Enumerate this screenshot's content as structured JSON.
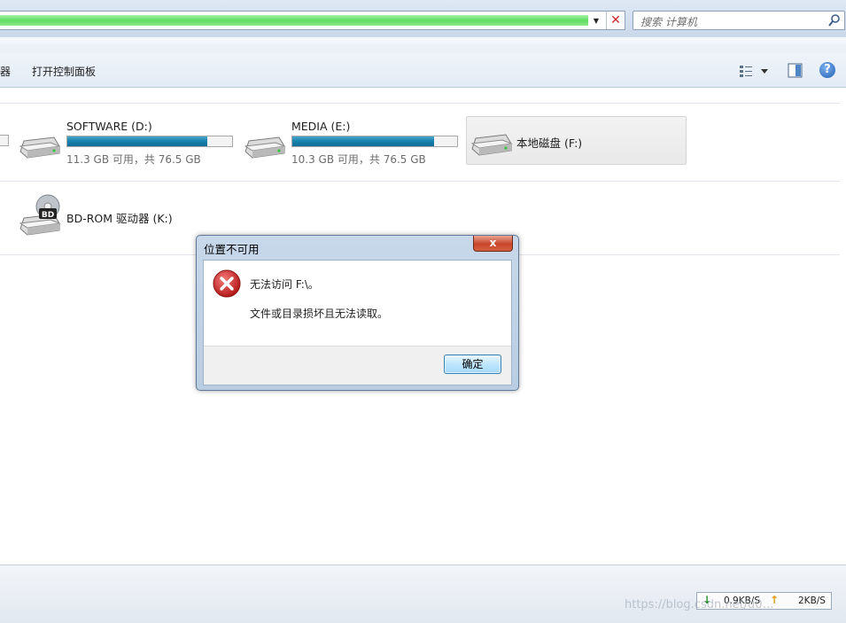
{
  "address_bar": {
    "search_placeholder": "搜索 计算机"
  },
  "toolbar": {
    "cut_label": "器",
    "open_control_panel": "打开控制面板"
  },
  "drives": [
    {
      "name": "SOFTWARE (D:)",
      "size": "11.3 GB 可用，共 76.5 GB",
      "used_fraction": 0.85
    },
    {
      "name": "MEDIA (E:)",
      "size": "10.3 GB 可用，共 76.5 GB",
      "used_fraction": 0.86
    },
    {
      "name": "本地磁盘 (F:)"
    },
    {
      "name": "BD-ROM 驱动器 (K:)",
      "badge": "BD"
    }
  ],
  "dialog": {
    "title": "位置不可用",
    "close": "x",
    "message1": "无法访问 F:\\。",
    "message2": "文件或目录损坏且无法读取。",
    "ok": "确定"
  },
  "status": {
    "download": "0.9KB/S",
    "upload": "2KB/S"
  },
  "watermark": "https://blog.csdn.net/u0…",
  "colors": {
    "drive_fill": "#1a84b0",
    "address_progress": "#5fdc5f",
    "error_red": "#d42a2a"
  }
}
